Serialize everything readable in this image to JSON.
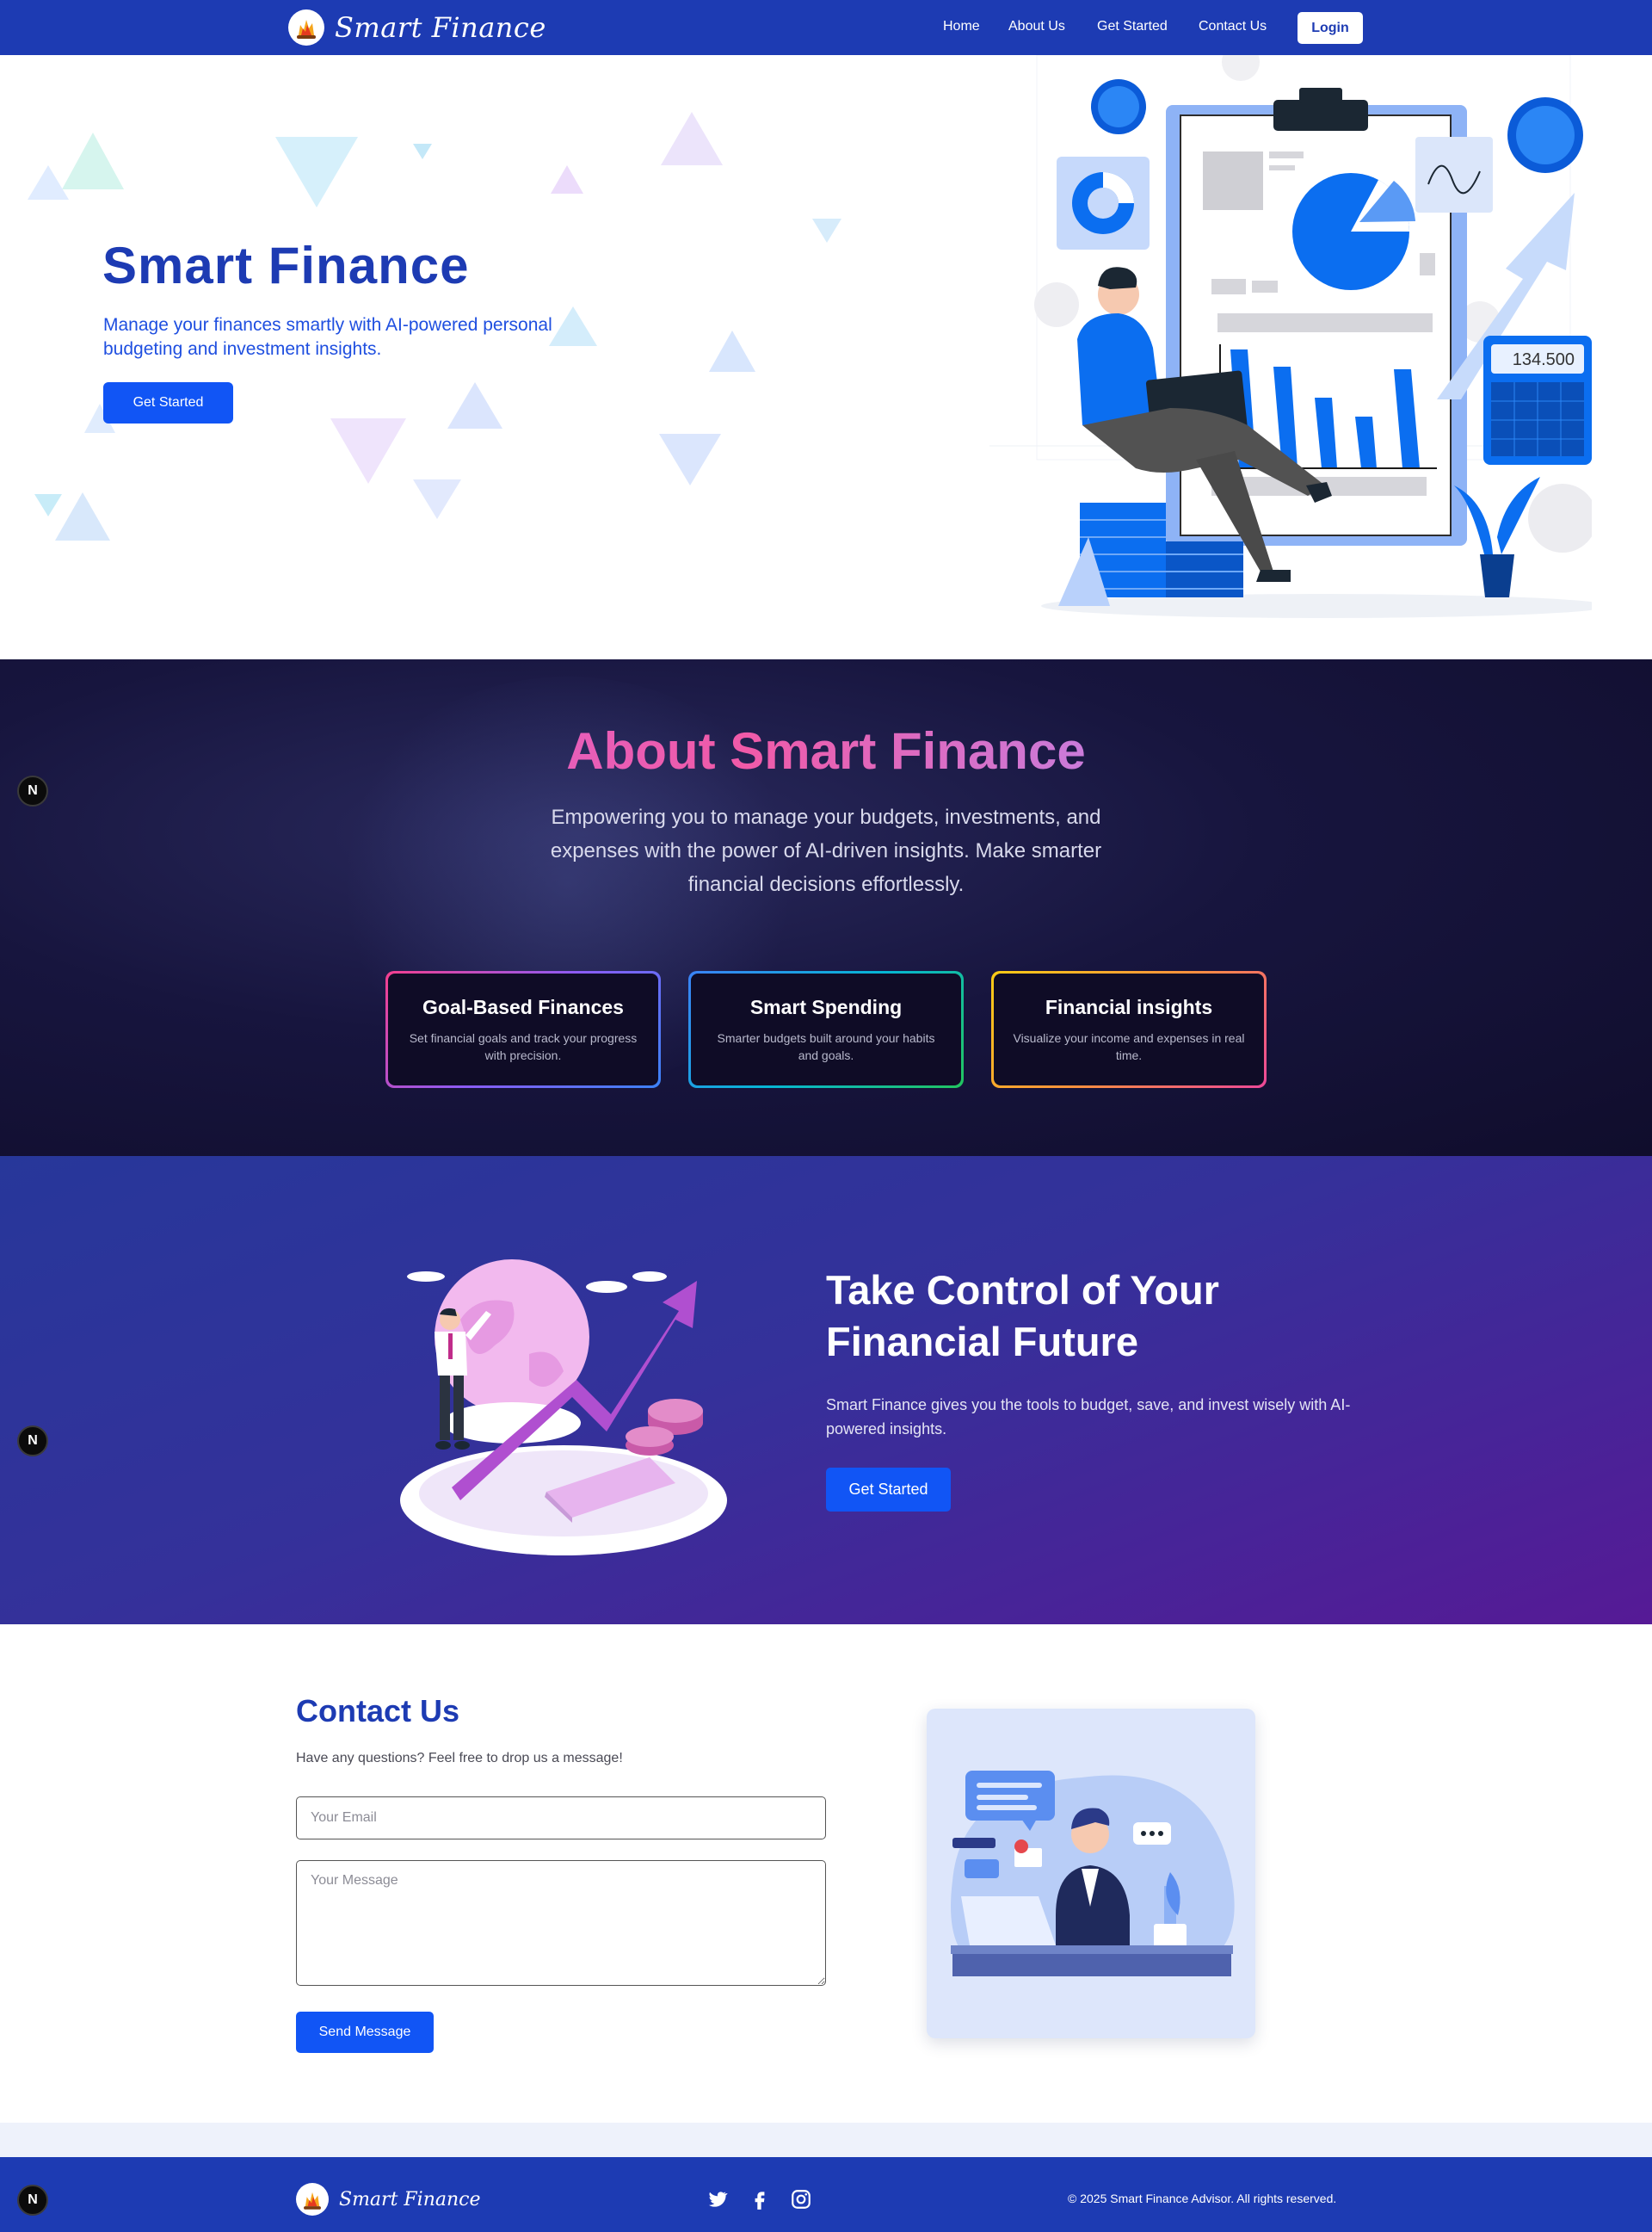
{
  "nav": {
    "brand": "Smart Finance",
    "links": [
      "Home",
      "About Us",
      "Get Started",
      "Contact Us"
    ],
    "login": "Login"
  },
  "hero": {
    "title": "Smart Finance",
    "subtitle": "Manage your finances smartly with AI-powered personal budgeting and investment insights.",
    "cta": "Get Started",
    "calculator_display": "134.500"
  },
  "about": {
    "title": "About Smart Finance",
    "text": "Empowering you to manage your budgets, investments, and expenses with the power of AI-driven insights. Make smarter financial decisions effortlessly.",
    "cards": [
      {
        "title": "Goal-Based Finances",
        "desc": "Set financial goals and track your progress with precision."
      },
      {
        "title": "Smart Spending",
        "desc": "Smarter budgets built around your habits and goals."
      },
      {
        "title": "Financial insights",
        "desc": "Visualize your income and expenses in real time."
      }
    ]
  },
  "control": {
    "title": "Take Control of Your Financial Future",
    "text": "Smart Finance gives you the tools to budget, save, and invest wisely with AI-powered insights.",
    "cta": "Get Started"
  },
  "contact": {
    "title": "Contact Us",
    "subtitle": "Have any questions? Feel free to drop us a message!",
    "email_placeholder": "Your Email",
    "message_placeholder": "Your Message",
    "send": "Send Message"
  },
  "footer": {
    "brand": "Smart Finance",
    "copyright": "© 2025 Smart Finance Advisor. All rights reserved.",
    "social": [
      "twitter-icon",
      "facebook-icon",
      "instagram-icon"
    ]
  },
  "dev_badge": "N",
  "colors": {
    "brand_blue": "#1d3bb3",
    "button_blue": "#1155f5",
    "about_bg": "#100d2c",
    "control_gradient_end": "#561a96"
  }
}
